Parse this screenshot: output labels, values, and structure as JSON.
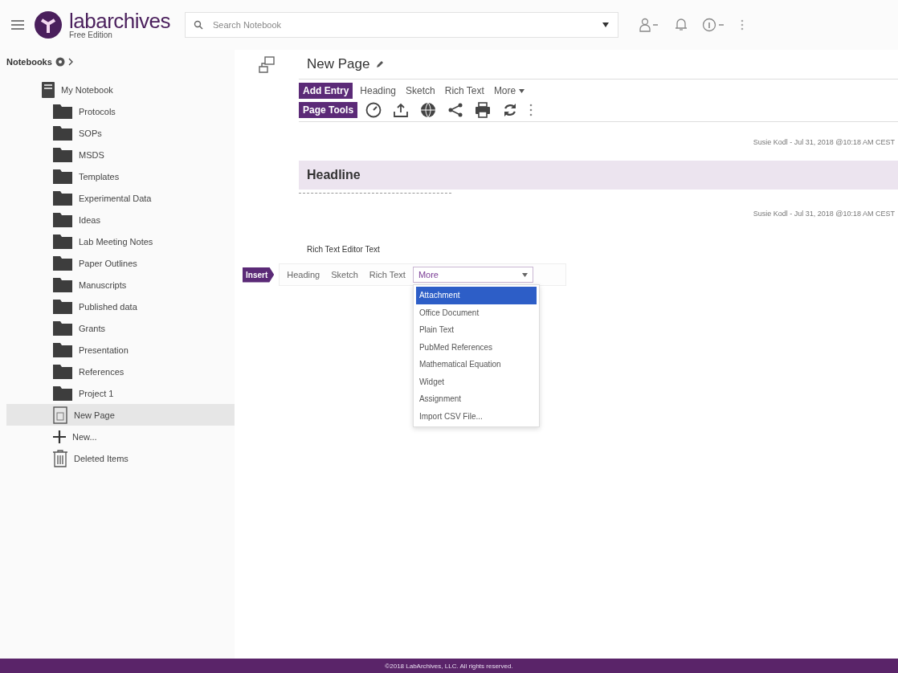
{
  "header": {
    "logo": {
      "name": "labarchives",
      "edition": "Free Edition"
    },
    "search": {
      "placeholder": "Search Notebook"
    }
  },
  "sidebar": {
    "title": "Notebooks",
    "items": [
      {
        "kind": "notebook",
        "label": "My Notebook",
        "selected": false,
        "children": [
          {
            "kind": "folder",
            "label": "Protocols",
            "selected": false
          },
          {
            "kind": "folder",
            "label": "SOPs",
            "selected": false
          },
          {
            "kind": "folder",
            "label": "MSDS",
            "selected": false
          },
          {
            "kind": "folder",
            "label": "Templates",
            "selected": false
          },
          {
            "kind": "folder",
            "label": "Experimental Data",
            "selected": false
          },
          {
            "kind": "folder",
            "label": "Ideas",
            "selected": false
          },
          {
            "kind": "folder",
            "label": "Lab Meeting Notes",
            "selected": false
          },
          {
            "kind": "folder",
            "label": "Paper Outlines",
            "selected": false
          },
          {
            "kind": "folder",
            "label": "Manuscripts",
            "selected": false
          },
          {
            "kind": "folder",
            "label": "Published data",
            "selected": false
          },
          {
            "kind": "folder",
            "label": "Grants",
            "selected": false
          },
          {
            "kind": "folder",
            "label": "Presentation",
            "selected": false
          },
          {
            "kind": "folder",
            "label": "References",
            "selected": false
          },
          {
            "kind": "folder",
            "label": "Project 1",
            "selected": false
          },
          {
            "kind": "page",
            "label": "New Page",
            "selected": true
          },
          {
            "kind": "new",
            "label": "New...",
            "selected": false
          },
          {
            "kind": "trash",
            "label": "Deleted Items",
            "selected": false
          }
        ]
      }
    ]
  },
  "page": {
    "title": "New Page",
    "add_entry": {
      "label": "Add Entry",
      "options": [
        "Heading",
        "Sketch",
        "Rich Text",
        "More"
      ]
    },
    "page_tools": {
      "label": "Page Tools"
    },
    "entries": [
      {
        "kind": "meta",
        "text": "Susie Kodl - Jul 31, 2018 @10:18 AM CEST"
      },
      {
        "kind": "heading",
        "text": "Headline"
      },
      {
        "kind": "meta",
        "text": "Susie Kodl - Jul 31, 2018 @10:18 AM CEST"
      },
      {
        "kind": "text",
        "text": "Rich Text Editor Text"
      }
    ],
    "insert": {
      "label": "Insert",
      "options": [
        "Heading",
        "Sketch",
        "Rich Text"
      ],
      "select": {
        "value": "More",
        "expanded": true,
        "items": [
          {
            "label": "Attachment",
            "selected": true
          },
          {
            "label": "Office Document",
            "selected": false
          },
          {
            "label": "Plain Text",
            "selected": false
          },
          {
            "label": "PubMed References",
            "selected": false
          },
          {
            "label": "Mathematical Equation",
            "selected": false
          },
          {
            "label": "Widget",
            "selected": false
          },
          {
            "label": "Assignment",
            "selected": false
          },
          {
            "label": "Import CSV File...",
            "selected": false
          }
        ]
      }
    }
  },
  "footer": {
    "text": "©2018 LabArchives, LLC. All rights reserved."
  }
}
